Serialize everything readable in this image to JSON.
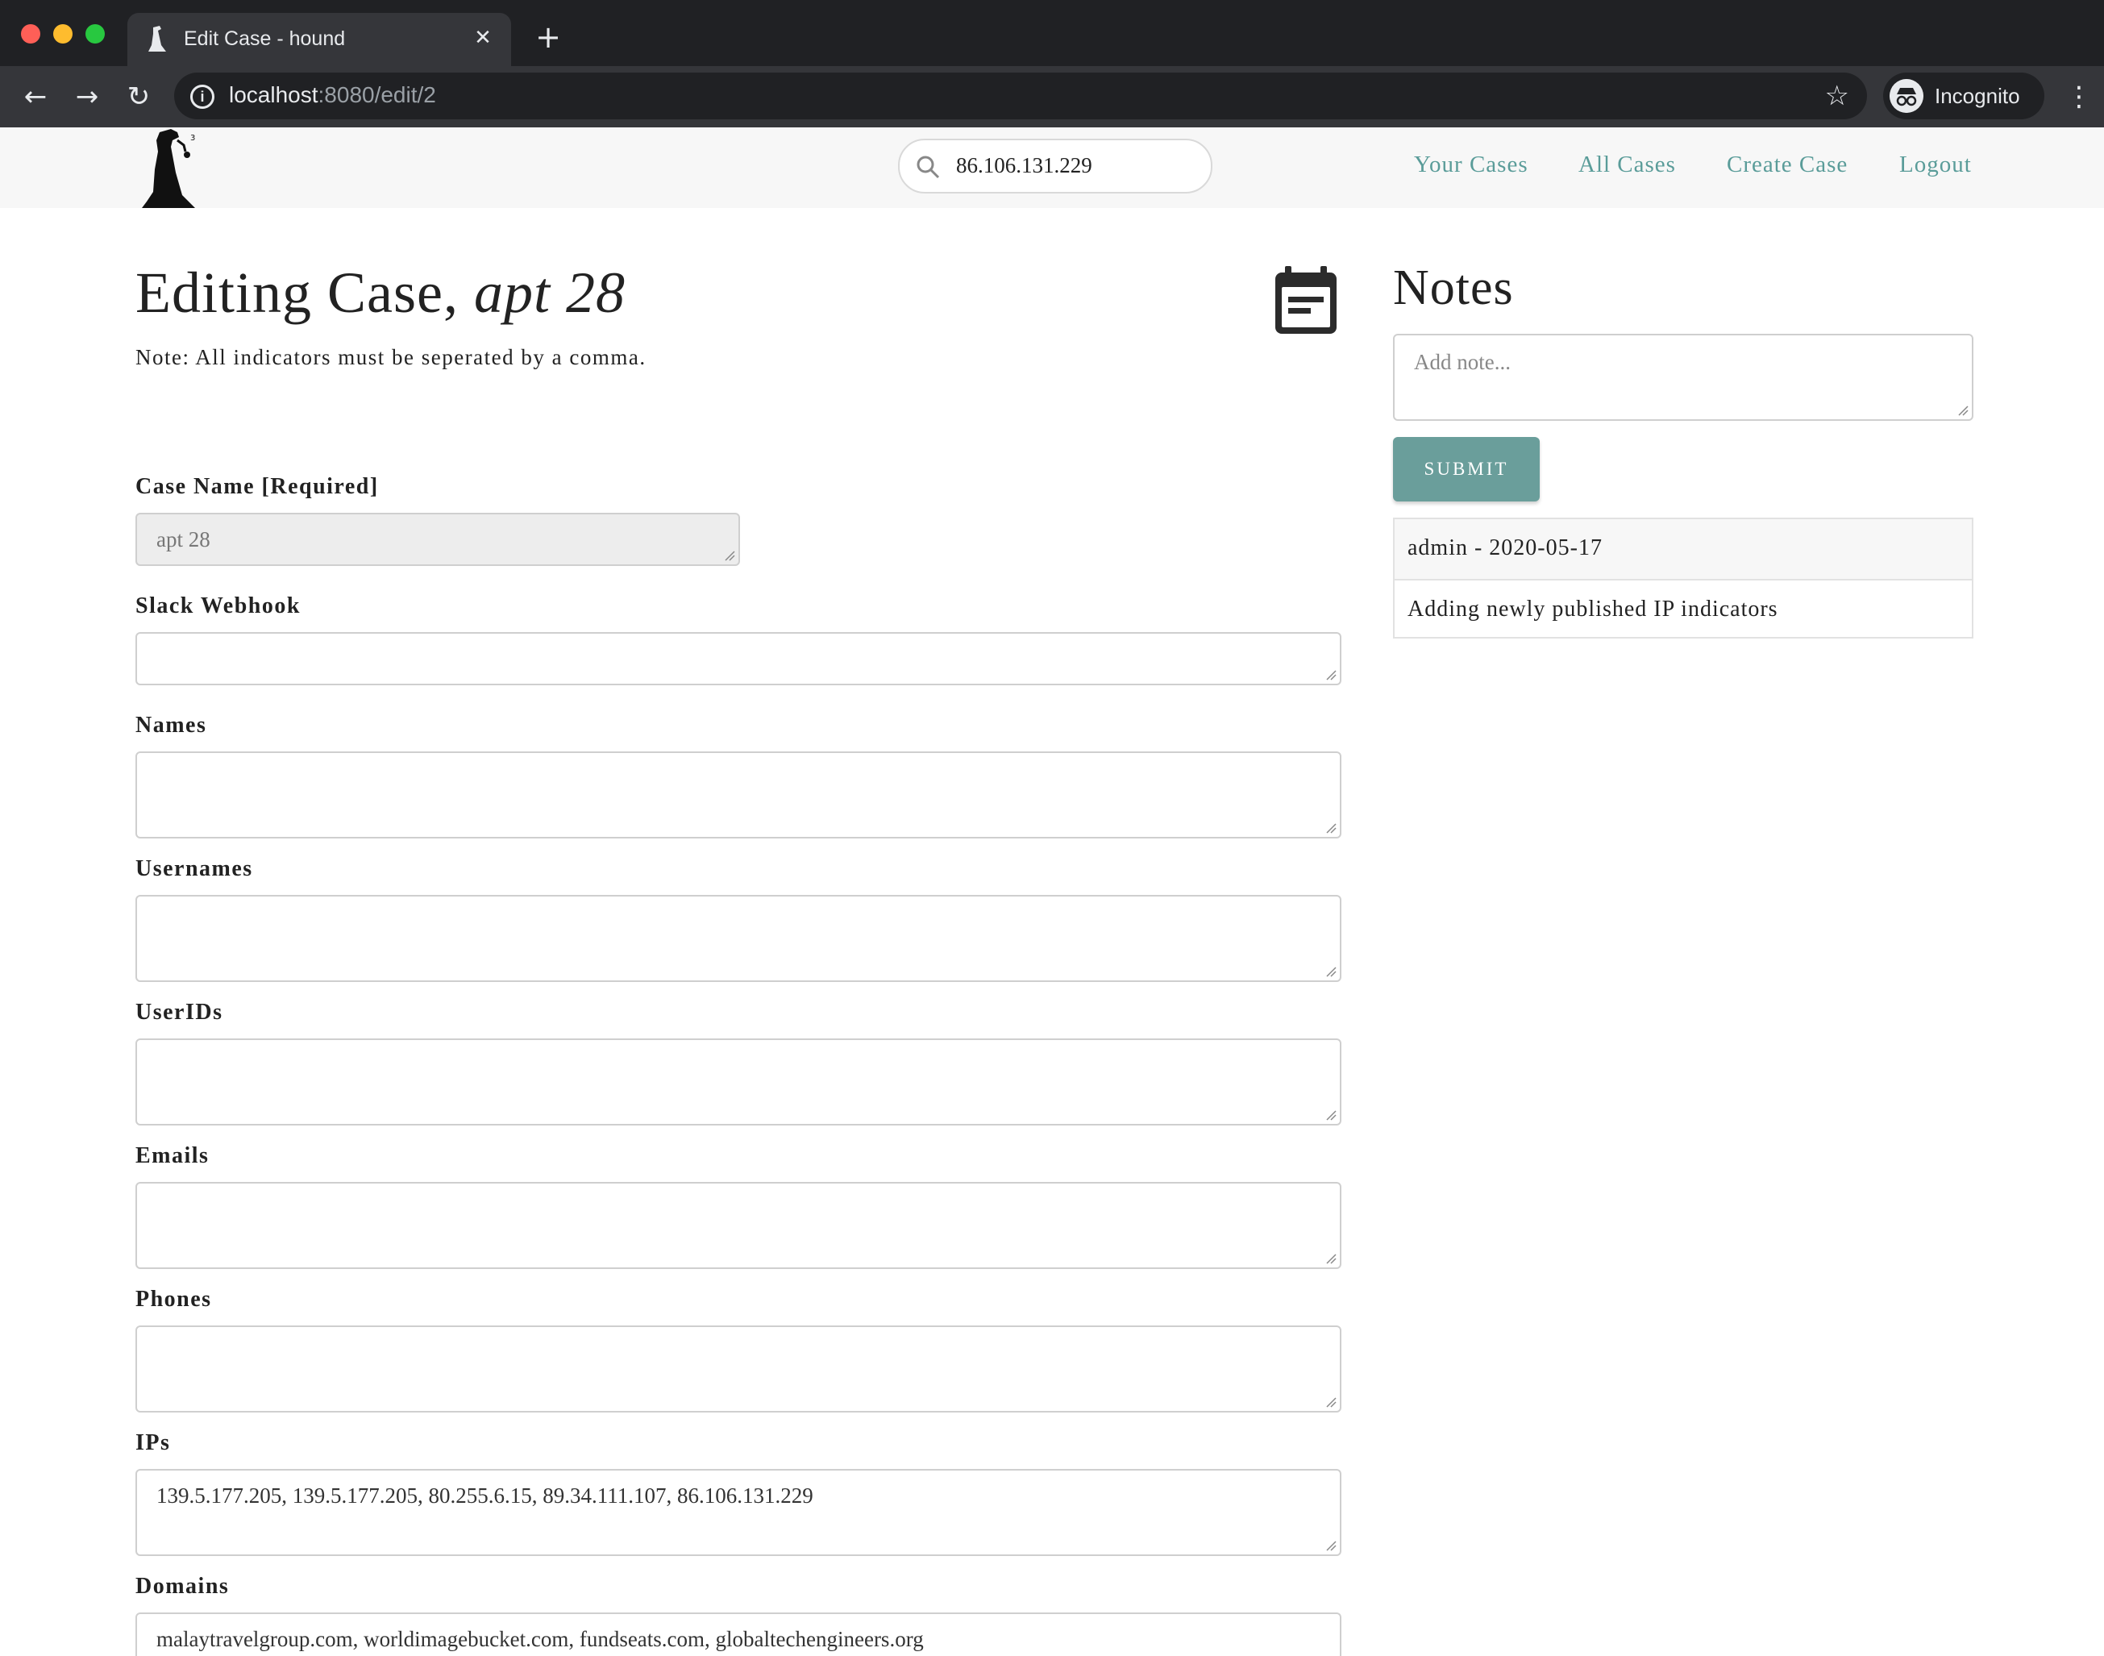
{
  "browser": {
    "tab_title": "Edit Case - hound",
    "url_host": "localhost",
    "url_path": ":8080/edit/2",
    "profile_label": "Incognito"
  },
  "header": {
    "search_value": "86.106.131.229",
    "nav": [
      "Your Cases",
      "All Cases",
      "Create Case",
      "Logout"
    ]
  },
  "main": {
    "title_prefix": "Editing Case, ",
    "title_case_name": "apt 28",
    "note": "Note: All indicators must be seperated by a comma.",
    "fields": [
      {
        "label": "Case Name [Required]",
        "value": "apt 28"
      },
      {
        "label": "Slack Webhook",
        "value": ""
      },
      {
        "label": "Names",
        "value": ""
      },
      {
        "label": "Usernames",
        "value": ""
      },
      {
        "label": "UserIDs",
        "value": ""
      },
      {
        "label": "Emails",
        "value": ""
      },
      {
        "label": "Phones",
        "value": ""
      },
      {
        "label": "IPs",
        "value": "139.5.177.205, 139.5.177.205, 80.255.6.15, 89.34.111.107, 86.106.131.229"
      },
      {
        "label": "Domains",
        "value": "malaytravelgroup.com, worldimagebucket.com, fundseats.com, globaltechengineers.org"
      }
    ]
  },
  "notes": {
    "title": "Notes",
    "placeholder": "Add note...",
    "submit_label": "SUBMIT",
    "items": [
      {
        "header": "admin - 2020-05-17",
        "body": "Adding newly published IP indicators"
      }
    ]
  },
  "colors": {
    "accent": "#5a9c99",
    "submit_bg": "#6a9e9b",
    "chrome_dark": "#202124"
  }
}
